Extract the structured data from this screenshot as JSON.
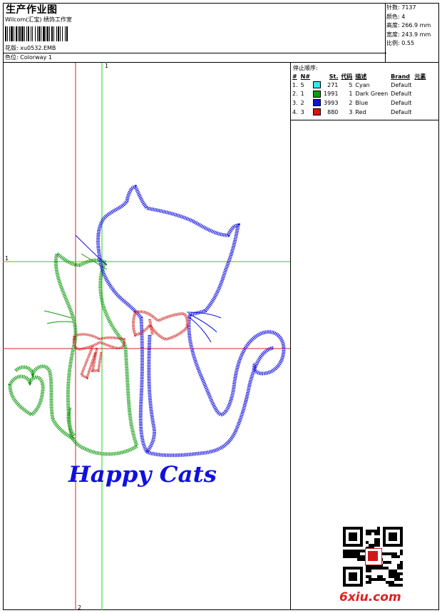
{
  "header": {
    "title": "生产作业图",
    "company": "Wilcom(汇宝) 绣饰工作室",
    "design_label": "花版:",
    "design_file": "xu0532.EMB",
    "colorway_label": "色位:",
    "colorway": "Colorway 1"
  },
  "stats": {
    "stitches": "针数: 7137",
    "colors": "颜色: 4",
    "height": "高度: 266.9 mm",
    "width": "宽度: 243.9 mm",
    "scale": "比例: 0.55"
  },
  "sequence": {
    "title": "停止顺序:",
    "headers": [
      "#",
      "N#",
      "St.",
      "代码",
      "描述",
      "Brand",
      "元素"
    ],
    "rows": [
      {
        "num": "1.",
        "n": "5",
        "color": "#30e8f0",
        "st": "271",
        "code": "5",
        "desc": "Cyan",
        "brand": "Default"
      },
      {
        "num": "2.",
        "n": "1",
        "color": "#109a10",
        "st": "1991",
        "code": "1",
        "desc": "Dark Green",
        "brand": "Default"
      },
      {
        "num": "3.",
        "n": "2",
        "color": "#1010e0",
        "st": "3993",
        "code": "2",
        "desc": "Blue",
        "brand": "Default"
      },
      {
        "num": "4.",
        "n": "3",
        "color": "#e01010",
        "st": "880",
        "code": "3",
        "desc": "Red",
        "brand": "Default"
      }
    ]
  },
  "canvas": {
    "marker_top": "1",
    "marker_left": "1",
    "marker_bottom": "2",
    "caption": "Happy Cats"
  },
  "watermark": "6xiu.com",
  "colors": {
    "guide_red": "#e02020",
    "guide_green": "#20d020",
    "blue": "#1010e0",
    "green": "#109a10",
    "red": "#d01818"
  }
}
